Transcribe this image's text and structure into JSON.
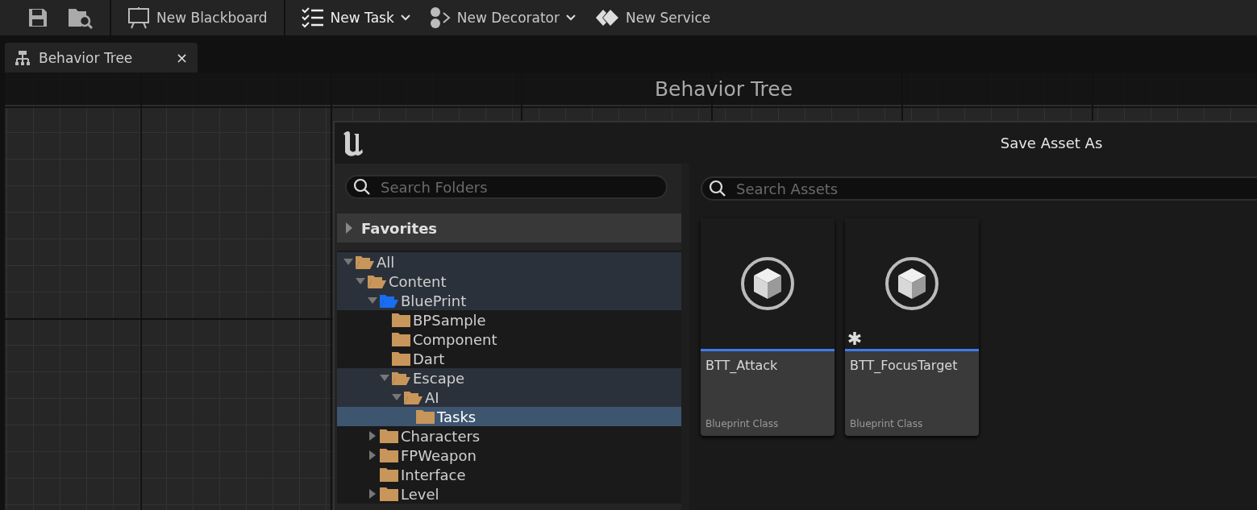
{
  "toolbar": {
    "items": [
      {
        "kind": "save"
      },
      {
        "kind": "browse"
      },
      {
        "kind": "blackboard",
        "label": "New Blackboard",
        "dropdown": false
      },
      {
        "kind": "task",
        "label": "New Task",
        "dropdown": true
      },
      {
        "kind": "decorator",
        "label": "New Decorator",
        "dropdown": true
      },
      {
        "kind": "service",
        "label": "New Service",
        "dropdown": false
      }
    ]
  },
  "tabs": [
    {
      "label": "Behavior Tree",
      "close": "×",
      "selected": true
    }
  ],
  "graph": {
    "title": "Behavior Tree"
  },
  "dialog": {
    "title": "Save Asset As",
    "folder_search": {
      "placeholder": "Search Folders"
    },
    "favorites": {
      "label": "Favorites",
      "expanded": false
    },
    "tree": [
      {
        "name": "All",
        "kind": "branch",
        "expanded": true,
        "selected": false,
        "color": "#c8965a",
        "children": [
          {
            "name": "Content",
            "kind": "branch",
            "expanded": true,
            "selected": false,
            "color": "#c8965a",
            "children": [
              {
                "name": "BluePrint",
                "kind": "branch",
                "expanded": true,
                "selected": false,
                "color": "#1a6cf0",
                "children": [
                  {
                    "name": "BPSample",
                    "kind": "leaf",
                    "expanded": false,
                    "selected": false,
                    "color": "#c8965a"
                  },
                  {
                    "name": "Component",
                    "kind": "leaf",
                    "expanded": false,
                    "selected": false,
                    "color": "#c8965a"
                  },
                  {
                    "name": "Dart",
                    "kind": "leaf",
                    "expanded": false,
                    "selected": false,
                    "color": "#c8965a"
                  },
                  {
                    "name": "Escape",
                    "kind": "branch",
                    "expanded": true,
                    "selected": false,
                    "color": "#c8965a",
                    "children": [
                      {
                        "name": "AI",
                        "kind": "branch",
                        "expanded": true,
                        "selected": false,
                        "color": "#c8965a",
                        "children": [
                          {
                            "name": "Tasks",
                            "kind": "leaf",
                            "expanded": false,
                            "selected": true,
                            "color": "#c8965a"
                          }
                        ]
                      }
                    ]
                  }
                ]
              },
              {
                "name": "Characters",
                "kind": "branch",
                "expanded": false,
                "selected": false,
                "color": "#c8965a"
              },
              {
                "name": "FPWeapon",
                "kind": "branch",
                "expanded": false,
                "selected": false,
                "color": "#c8965a"
              },
              {
                "name": "Interface",
                "kind": "leaf",
                "expanded": false,
                "selected": false,
                "color": "#c8965a"
              },
              {
                "name": "Level",
                "kind": "branch",
                "expanded": false,
                "selected": false,
                "color": "#c8965a"
              }
            ]
          }
        ]
      }
    ],
    "asset_search": {
      "placeholder": "Search Assets"
    },
    "assets": [
      {
        "name": "BTT_Attack",
        "type": "Blueprint Class",
        "unsaved": false
      },
      {
        "name": "BTT_FocusTarget",
        "type": "Blueprint Class",
        "unsaved": true
      }
    ]
  }
}
